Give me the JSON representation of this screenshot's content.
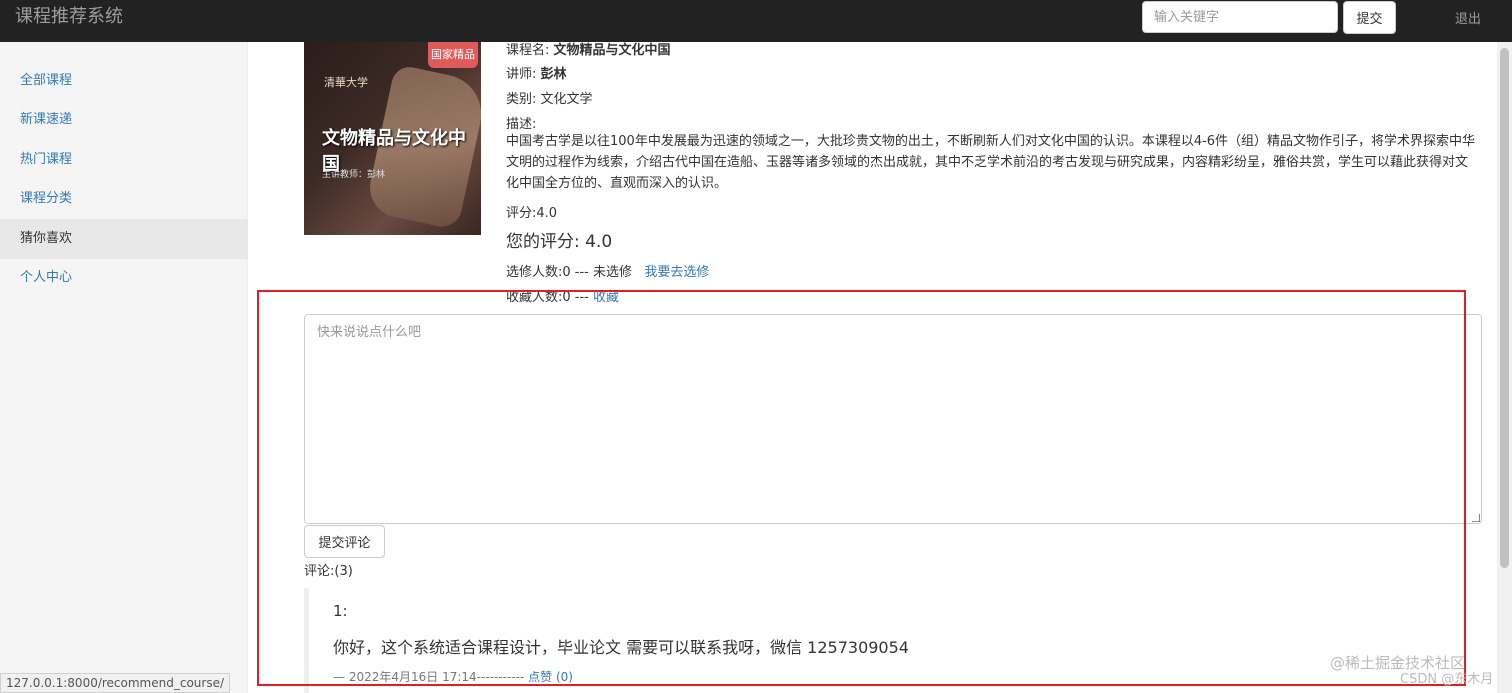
{
  "navbar": {
    "brand": "课程推荐系统",
    "search_placeholder": "输入关键字",
    "search_button": "提交",
    "logout": "退出"
  },
  "sidebar": {
    "items": [
      {
        "label": "全部课程"
      },
      {
        "label": "新课速递"
      },
      {
        "label": "热门课程"
      },
      {
        "label": "课程分类"
      },
      {
        "label": "猜你喜欢",
        "active": true
      },
      {
        "label": "个人中心"
      }
    ]
  },
  "course": {
    "cover": {
      "badge": "国家精品",
      "seal": "清華大学",
      "title": "文物精品与文化中国",
      "subtitle": "主讲教师：彭林"
    },
    "name_label": "课程名: ",
    "name": "文物精品与文化中国",
    "teacher_label": "讲师: ",
    "teacher": "彭林",
    "category": "类别: 文化文学",
    "desc_label": "描述:",
    "description": "中国考古学是以往100年中发展最为迅速的领域之一，大批珍贵文物的出土，不断刷新人们对文化中国的认识。本课程以4-6件（组）精品文物作引子，将学术界探索中华文明的过程作为线索，介绍古代中国在造船、玉器等诸多领域的杰出成就，其中不乏学术前沿的考古发现与研究成果，内容精彩纷呈，雅俗共赏，学生可以藉此获得对文化中国全方位的、直观而深入的认识。",
    "score": "评分:4.0",
    "my_score": "您的评分: 4.0",
    "enroll_text": "选修人数:0 --- 未选修",
    "enroll_link": "我要去选修",
    "collect_text": "收藏人数:0 --- ",
    "collect_link": "收藏"
  },
  "comment_form": {
    "placeholder": "快来说说点什么吧",
    "submit": "提交评论",
    "count": "评论:(3)"
  },
  "comments": [
    {
      "index": "1:",
      "text": "你好，这个系统适合课程设计，毕业论文 需要可以联系我呀，微信 1257309054",
      "meta": "— 2022年4月16日 17:14-----------",
      "like": "点赞 (0)"
    }
  ],
  "status_bar": {
    "url": "127.0.0.1:8000/recommend_course/"
  },
  "watermarks": {
    "line1": "@稀土掘金技术社区",
    "line2": "CSDN @东木月"
  },
  "annotation_color": "#e02020"
}
